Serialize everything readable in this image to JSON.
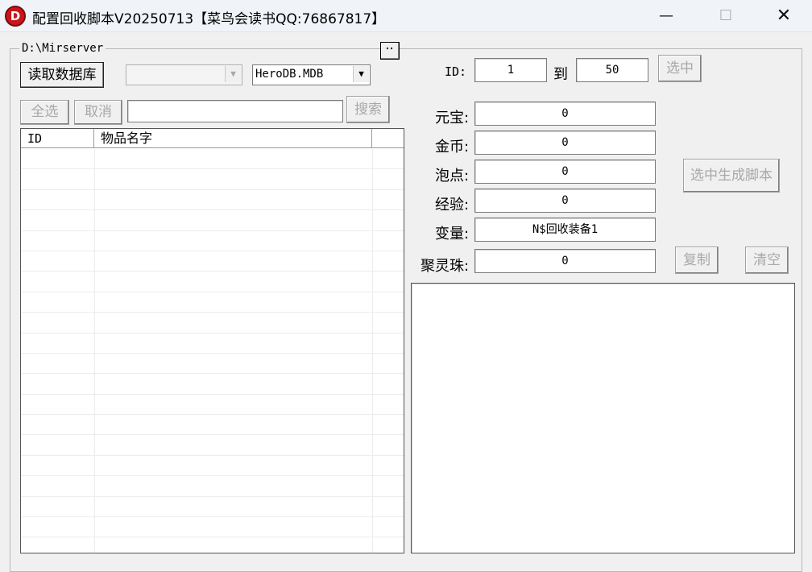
{
  "window": {
    "icon_letter": "D",
    "title": "配置回收脚本V20250713【菜鸟会读书QQ:76867817】",
    "minimize": "—",
    "maximize": "☐",
    "close": "✕"
  },
  "group": {
    "path_label": "D:\\Mirserver",
    "browse_button": "⋅⋅"
  },
  "left": {
    "read_db_button": "读取数据库",
    "table_combo_value": "",
    "db_combo_value": "HeroDB.MDB",
    "select_all_button": "全选",
    "cancel_button": "取消",
    "search_input_value": "",
    "search_button": "搜索",
    "list": {
      "columns": [
        "ID",
        "物品名字",
        ""
      ],
      "rows": []
    }
  },
  "right": {
    "id_label": "ID:",
    "id_from": "1",
    "to_label": "到",
    "id_to": "50",
    "select_button": "选中",
    "fields": [
      {
        "label": "元宝:",
        "value": "0"
      },
      {
        "label": "金币:",
        "value": "0"
      },
      {
        "label": "泡点:",
        "value": "0"
      },
      {
        "label": "经验:",
        "value": "0"
      },
      {
        "label": "变量:",
        "value": "N$回收装备1"
      },
      {
        "label": "聚灵珠:",
        "value": "0"
      }
    ],
    "generate_button": "选中生成脚本",
    "copy_button": "复制",
    "clear_button": "清空",
    "output_text": ""
  }
}
